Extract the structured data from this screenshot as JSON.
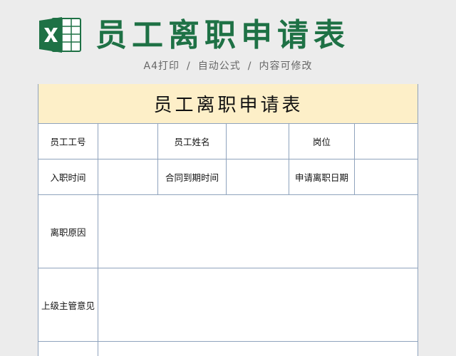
{
  "header": {
    "title": "员工离职申请表",
    "subtitle_items": [
      "A4打印",
      "自动公式",
      "内容可修改"
    ],
    "subtitle_separator": "/",
    "icon": "excel-icon",
    "colors": {
      "title": "#1e7145",
      "icon_green": "#1e7145",
      "sheet_title_bg": "#fdefc8",
      "border": "#8fa3bd"
    }
  },
  "form": {
    "title": "员工离职申请表",
    "row1": {
      "label1": "员工工号",
      "value1": "",
      "label2": "员工姓名",
      "value2": "",
      "label3": "岗位",
      "value3": ""
    },
    "row2": {
      "label1": "入职时间",
      "value1": "",
      "label2": "合同到期时间",
      "value2": "",
      "label3": "申请离职日期",
      "value3": ""
    },
    "reason": {
      "label": "离职原因",
      "value": ""
    },
    "supervisor": {
      "label": "上级主管意见",
      "value": ""
    }
  }
}
